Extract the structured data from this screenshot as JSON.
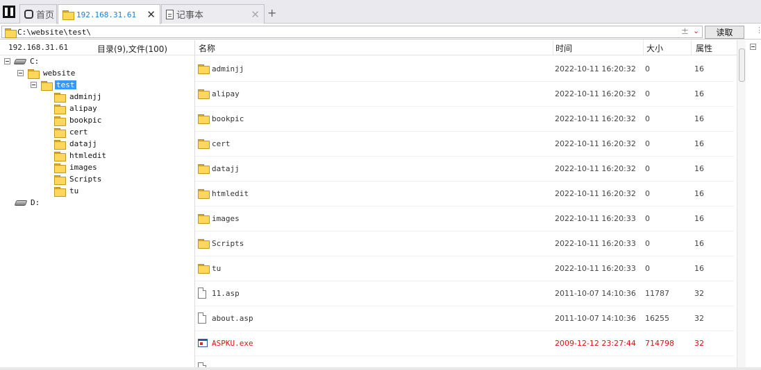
{
  "tabs": [
    {
      "label": "首页",
      "icon": "home-icon"
    },
    {
      "label": "192.168.31.61",
      "icon": "folder-icon"
    },
    {
      "label": "记事本",
      "icon": "document-icon"
    }
  ],
  "tab_add": "+",
  "tab_close": "✕",
  "address": {
    "path": "C:\\website\\test\\",
    "plusminus": "±",
    "read_button": "读取"
  },
  "left_panel": {
    "host": "192.168.31.61",
    "summary": "目录(9),文件(100)",
    "tree": [
      {
        "label": "C:",
        "icon": "drive-icon"
      },
      {
        "label": "website",
        "icon": "folder-icon"
      },
      {
        "label": "test",
        "icon": "folder-icon",
        "selected": true
      },
      {
        "label": "adminjj",
        "icon": "folder-icon"
      },
      {
        "label": "alipay",
        "icon": "folder-icon"
      },
      {
        "label": "bookpic",
        "icon": "folder-icon"
      },
      {
        "label": "cert",
        "icon": "folder-icon"
      },
      {
        "label": "datajj",
        "icon": "folder-icon"
      },
      {
        "label": "htmledit",
        "icon": "folder-icon"
      },
      {
        "label": "images",
        "icon": "folder-icon"
      },
      {
        "label": "Scripts",
        "icon": "folder-icon"
      },
      {
        "label": "tu",
        "icon": "folder-icon"
      },
      {
        "label": "D:",
        "icon": "drive-icon"
      }
    ]
  },
  "file_list": {
    "columns": [
      "名称",
      "时间",
      "大小",
      "属性"
    ],
    "rows": [
      {
        "name": "adminjj",
        "time": "2022-10-11 16:20:32",
        "size": "0",
        "attr": "16",
        "type": "folder"
      },
      {
        "name": "alipay",
        "time": "2022-10-11 16:20:32",
        "size": "0",
        "attr": "16",
        "type": "folder"
      },
      {
        "name": "bookpic",
        "time": "2022-10-11 16:20:32",
        "size": "0",
        "attr": "16",
        "type": "folder"
      },
      {
        "name": "cert",
        "time": "2022-10-11 16:20:32",
        "size": "0",
        "attr": "16",
        "type": "folder"
      },
      {
        "name": "datajj",
        "time": "2022-10-11 16:20:32",
        "size": "0",
        "attr": "16",
        "type": "folder"
      },
      {
        "name": "htmledit",
        "time": "2022-10-11 16:20:32",
        "size": "0",
        "attr": "16",
        "type": "folder"
      },
      {
        "name": "images",
        "time": "2022-10-11 16:20:33",
        "size": "0",
        "attr": "16",
        "type": "folder"
      },
      {
        "name": "Scripts",
        "time": "2022-10-11 16:20:33",
        "size": "0",
        "attr": "16",
        "type": "folder"
      },
      {
        "name": "tu",
        "time": "2022-10-11 16:20:33",
        "size": "0",
        "attr": "16",
        "type": "folder"
      },
      {
        "name": "11.asp",
        "time": "2011-10-07 14:10:36",
        "size": "11787",
        "attr": "32",
        "type": "file"
      },
      {
        "name": "about.asp",
        "time": "2011-10-07 14:10:36",
        "size": "16255",
        "attr": "32",
        "type": "file"
      },
      {
        "name": "ASPKU.exe",
        "time": "2009-12-12 23:27:44",
        "size": "714798",
        "attr": "32",
        "type": "exe",
        "highlight_color": "#e01010"
      }
    ]
  },
  "colors": {
    "accent": "#1a7fd0",
    "selection": "#3399ff",
    "executable": "#e01010"
  }
}
